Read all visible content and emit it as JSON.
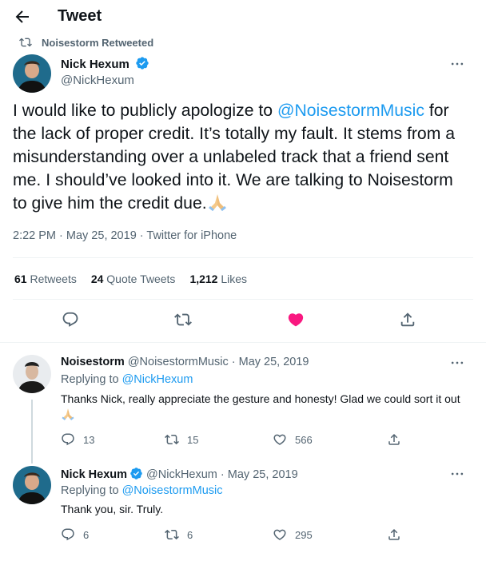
{
  "header": {
    "title": "Tweet"
  },
  "retweet_context": {
    "label": "Noisestorm Retweeted"
  },
  "main_tweet": {
    "author_name": "Nick Hexum",
    "author_handle": "@NickHexum",
    "text_before": "I would like to publicly apologize to ",
    "mention": "@NoisestormMusic",
    "text_after": " for the lack of proper credit. It’s totally my fault. It stems from a misunderstanding over a unlabeled track that a friend sent me.  I should’ve looked into it. We are talking to Noisestorm to give him the credit due.",
    "time": "2:22 PM",
    "date": "May 25, 2019",
    "source": "Twitter for iPhone",
    "stats": {
      "retweets_count": "61",
      "retweets_label": "Retweets",
      "quotes_count": "24",
      "quotes_label": "Quote Tweets",
      "likes_count": "1,212",
      "likes_label": "Likes"
    }
  },
  "replies": [
    {
      "author_name": "Noisestorm",
      "author_handle": "@NoisestormMusic",
      "date": "May 25, 2019",
      "replying_prefix": "Replying to ",
      "replying_to": "@NickHexum",
      "text": "Thanks Nick, really appreciate the gesture and honesty!  Glad we could sort it out",
      "reply_count": "13",
      "retweet_count": "15",
      "like_count": "566"
    },
    {
      "author_name": "Nick Hexum",
      "author_handle": "@NickHexum",
      "date": "May 25, 2019",
      "replying_prefix": "Replying to ",
      "replying_to": "@NoisestormMusic",
      "text": "Thank you, sir. Truly.",
      "reply_count": "6",
      "retweet_count": "6",
      "like_count": "295"
    }
  ],
  "separator": " · ",
  "colors": {
    "accent": "#1d9bf0",
    "like_active": "#f91880",
    "muted": "#536471",
    "text": "#0f1419"
  },
  "icons": [
    "back-arrow-icon",
    "retweet-icon",
    "verified-badge-icon",
    "more-icon",
    "reply-icon",
    "like-icon",
    "share-icon",
    "pray-emoji-icon"
  ]
}
